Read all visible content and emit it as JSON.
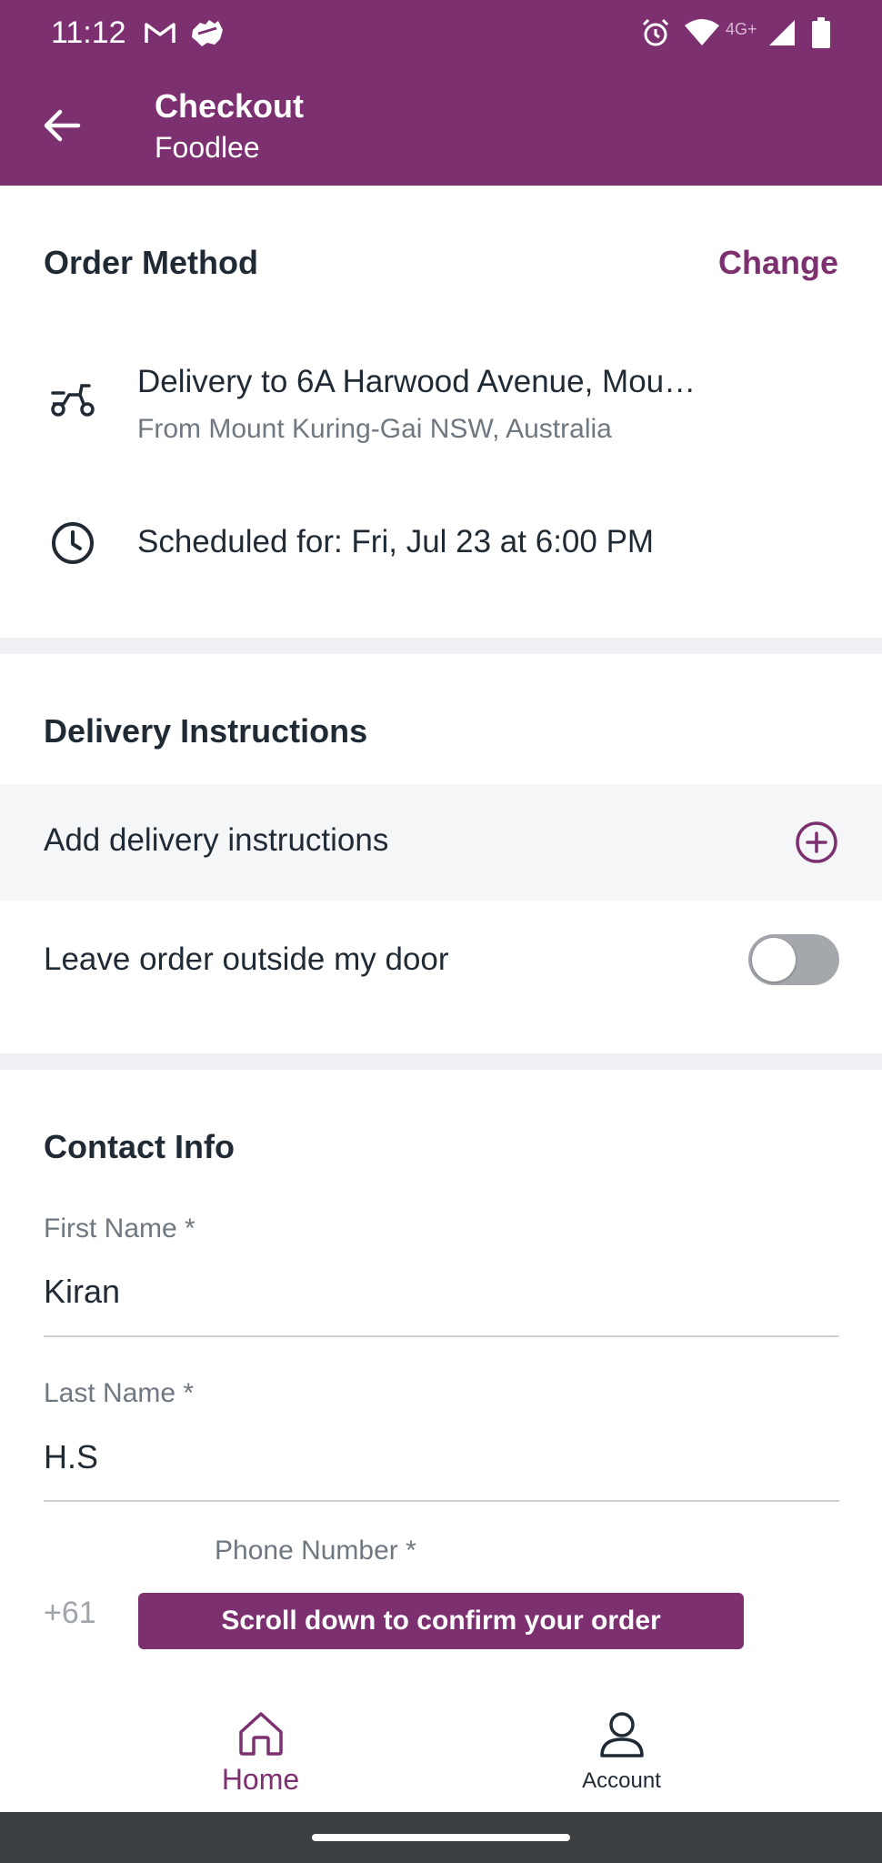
{
  "status_bar": {
    "time": "11:12",
    "network_label": "4G+",
    "icons": [
      "gmail-icon",
      "australia-map-icon",
      "alarm-icon",
      "wifi-icon",
      "cell-signal-icon",
      "battery-icon"
    ]
  },
  "app_bar": {
    "title": "Checkout",
    "subtitle": "Foodlee",
    "back_icon": "arrow-left-icon"
  },
  "order_method": {
    "title": "Order Method",
    "change_label": "Change",
    "delivery": {
      "icon": "scooter-icon",
      "main": "Delivery to 6A Harwood Avenue, Mou…",
      "sub": "From Mount Kuring-Gai NSW, Australia"
    },
    "schedule": {
      "icon": "clock-icon",
      "text": "Scheduled for: Fri, Jul 23 at 6:00 PM"
    }
  },
  "delivery_instructions": {
    "title": "Delivery Instructions",
    "add_label": "Add delivery instructions",
    "add_icon": "plus-circle-icon",
    "leave_outside_label": "Leave order outside my door",
    "leave_outside_on": false
  },
  "contact_info": {
    "title": "Contact Info",
    "first_name": {
      "label": "First Name *",
      "value": "Kiran"
    },
    "last_name": {
      "label": "Last Name *",
      "value": "H.S"
    },
    "phone": {
      "label": "Phone Number *",
      "prefix": "+61"
    }
  },
  "toast": "Scroll down to confirm your order",
  "bottom_nav": [
    {
      "label": "Home",
      "icon": "home-icon",
      "active": true
    },
    {
      "label": "Account",
      "icon": "account-icon",
      "active": false
    }
  ],
  "colors": {
    "brand": "#7d3070",
    "text": "#1f2a35",
    "muted": "#6f7780",
    "divider": "#eef0f3"
  }
}
